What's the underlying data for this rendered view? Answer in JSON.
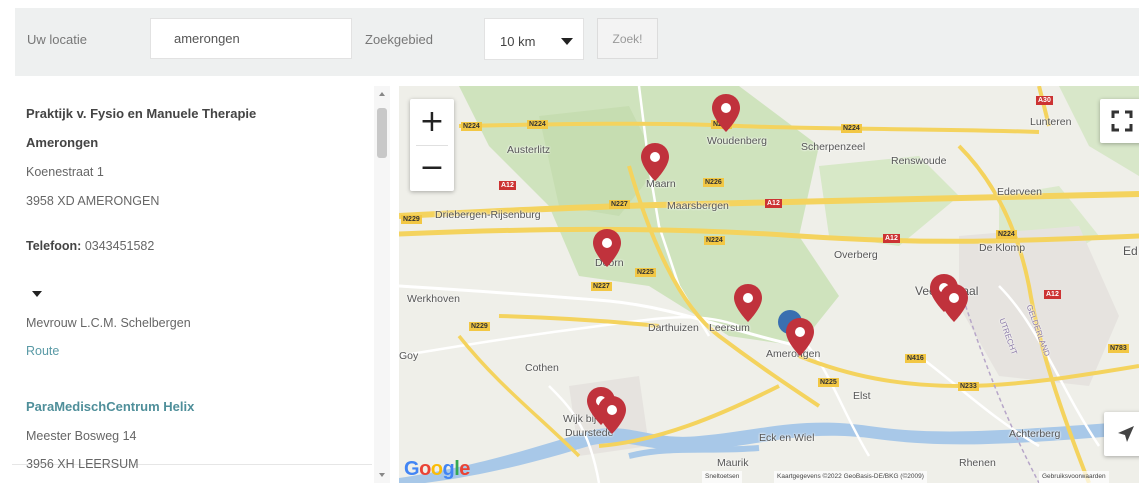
{
  "search": {
    "location_label": "Uw locatie",
    "location_value": "amerongen",
    "area_label": "Zoekgebied",
    "area_value": "10 km",
    "button_label": "Zoek!"
  },
  "results": [
    {
      "name_line1": "Praktijk v. Fysio en Manuele Therapie",
      "name_line2": "Amerongen",
      "street": "Koenestraat 1",
      "postal": "3958 XD AMERONGEN",
      "phone_label": "Telefoon:",
      "phone": "0343451582",
      "contact": "Mevrouw L.C.M. Schelbergen",
      "route": "Route"
    },
    {
      "name_line1": "ParaMedischCentrum Helix",
      "street": "Meester Bosweg 14",
      "postal": "3956 XH LEERSUM"
    }
  ],
  "map": {
    "zoom_in": "+",
    "zoom_out": "−",
    "places": {
      "austerlitz": "Austerlitz",
      "woudenberg": "Woudenberg",
      "scherpenzeel": "Scherpenzeel",
      "renswoude": "Renswoude",
      "lunteren": "Lunteren",
      "maarn": "Maarn",
      "maarsbergen": "Maarsbergen",
      "ederveen": "Ederveen",
      "driebergen": "Driebergen-Rijsenburg",
      "doorn": "Doorn",
      "overberg": "Overberg",
      "deklomp": "De Klomp",
      "ed": "Ed",
      "werkhoven": "Werkhoven",
      "veenendaal": "Veenendaal",
      "darthuizen": "Darthuizen",
      "leersum": "Leersum",
      "amerongen": "Amerongen",
      "goy": "Goy",
      "cothen": "Cothen",
      "elst": "Elst",
      "wijk": "Wijk bij",
      "duurstede": "Duurstede",
      "eckenwiel": "Eck en Wiel",
      "achterberg": "Achterberg",
      "maurik": "Maurik",
      "rhenen": "Rhenen",
      "utrecht_label": "UTRECHT",
      "gelderland_label": "GELDERLAND"
    },
    "roads": {
      "n224a": "N224",
      "n224b": "N224",
      "n224c": "N224",
      "n224d": "N224",
      "n224e": "N224",
      "n226": "N226",
      "n227a": "N227",
      "n227b": "N227",
      "n225a": "N225",
      "n225b": "N225",
      "n229a": "N229",
      "n229b": "N229",
      "n416": "N416",
      "n233": "N233",
      "n783": "N783",
      "a12a": "A12",
      "a12b": "A12",
      "a12c": "A12",
      "a12d": "A12",
      "a30": "A30"
    },
    "google": [
      "G",
      "o",
      "o",
      "g",
      "l",
      "e"
    ],
    "attribution": {
      "shortcuts": "Sneltoetsen",
      "mapdata": "Kaartgegevens ©2022 GeoBasis-DE/BKG (©2009)",
      "terms": "Gebruiksvoorwaarden"
    }
  },
  "colors": {
    "pin": "#c0323c",
    "center_marker": "#3a6fb0",
    "forest": "#cfe3bd",
    "road_major": "#f4d35e",
    "road_minor": "#ffffff",
    "water": "#a8c8e8",
    "link": "#4f8f9a"
  }
}
